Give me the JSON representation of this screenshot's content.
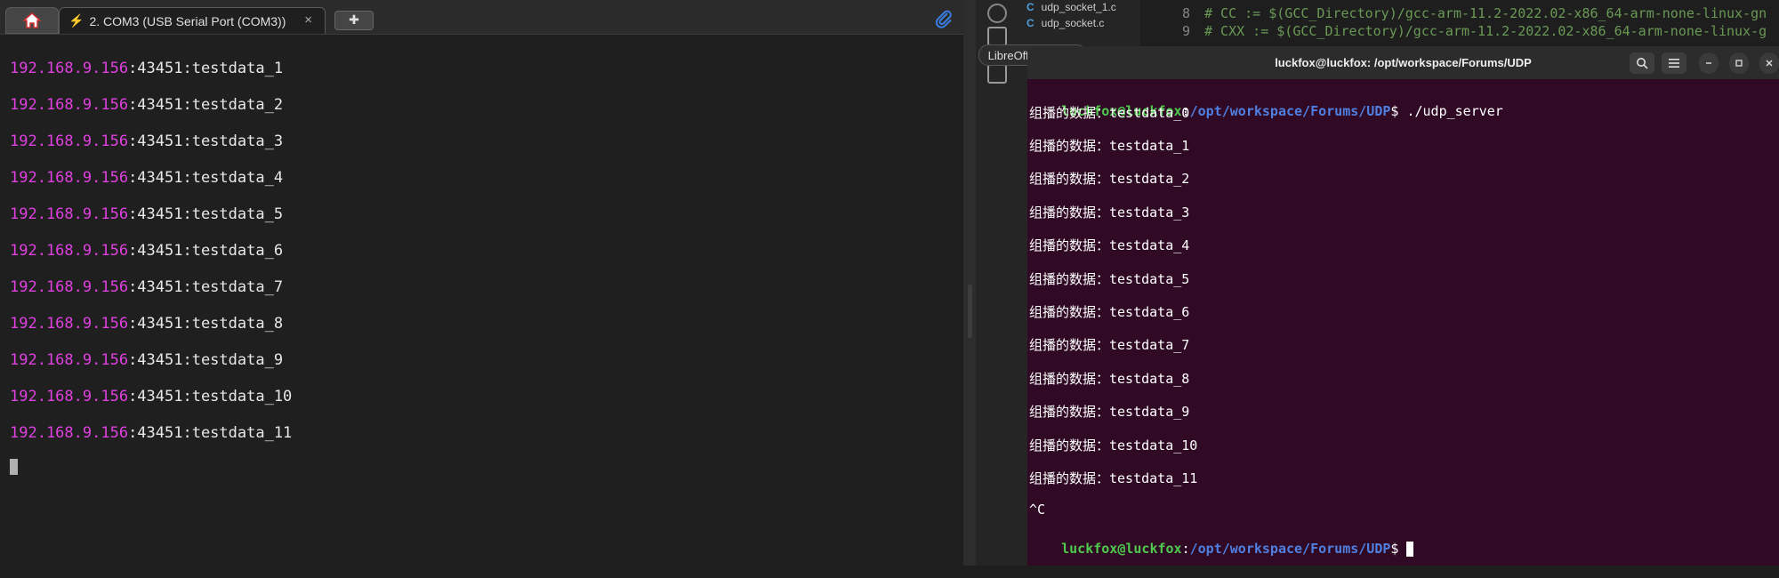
{
  "left_terminal": {
    "tab_label": "2. COM3  (USB Serial Port (COM3))",
    "tab_close": "×",
    "new_tab_symbol": "✚",
    "lines": [
      {
        "ip": "192.168.9.156",
        "rest": ":43451:testdata_1"
      },
      {
        "ip": "192.168.9.156",
        "rest": ":43451:testdata_2"
      },
      {
        "ip": "192.168.9.156",
        "rest": ":43451:testdata_3"
      },
      {
        "ip": "192.168.9.156",
        "rest": ":43451:testdata_4"
      },
      {
        "ip": "192.168.9.156",
        "rest": ":43451:testdata_5"
      },
      {
        "ip": "192.168.9.156",
        "rest": ":43451:testdata_6"
      },
      {
        "ip": "192.168.9.156",
        "rest": ":43451:testdata_7"
      },
      {
        "ip": "192.168.9.156",
        "rest": ":43451:testdata_8"
      },
      {
        "ip": "192.168.9.156",
        "rest": ":43451:testdata_9"
      },
      {
        "ip": "192.168.9.156",
        "rest": ":43451:testdata_10"
      },
      {
        "ip": "192.168.9.156",
        "rest": ":43451:testdata_11"
      }
    ]
  },
  "vscode": {
    "explorer_files": [
      "udp_socket_1.c",
      "udp_socket.c"
    ],
    "file_icon_letter": "C",
    "code_lines": [
      {
        "num": "8",
        "text": "# CC := $(GCC_Directory)/gcc-arm-11.2-2022.02-x86_64-arm-none-linux-gn"
      },
      {
        "num": "9",
        "text": "# CXX := $(GCC_Directory)/gcc-arm-11.2-2022.02-x86_64-arm-none-linux-g"
      }
    ],
    "tooltip": "LibreOffice Writer"
  },
  "ubuntu_terminal": {
    "title": "luckfox@luckfox: /opt/workspace/Forums/UDP",
    "prompt_user": "luckfox@luckfox",
    "prompt_path": "/opt/workspace/Forums/UDP",
    "prompt_sep": ":",
    "prompt_end": "$ ",
    "command": "./udp_server",
    "first_message": "组播的数据：testdata_0",
    "messages": [
      "组播的数据：testdata_1",
      "组播的数据：testdata_2",
      "组播的数据：testdata_3",
      "组播的数据：testdata_4",
      "组播的数据：testdata_5",
      "组播的数据：testdata_6",
      "组播的数据：testdata_7",
      "组播的数据：testdata_8",
      "组播的数据：testdata_9",
      "组播的数据：testdata_10",
      "组播的数据：testdata_11"
    ],
    "interrupt": "^C"
  },
  "colors": {
    "ip_magenta": "#e040e0",
    "ubuntu_bg": "#300a24",
    "prompt_green": "#4ec94e",
    "prompt_blue": "#4f7fe0"
  }
}
